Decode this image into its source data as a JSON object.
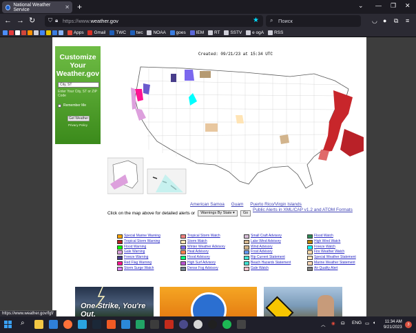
{
  "browser": {
    "tab_title": "National Weather Service",
    "url_prefix": "https://www.",
    "url_host": "weather.gov",
    "search_placeholder": "Поиск",
    "new_tab": "+",
    "bookmarks": [
      {
        "label": "Apps",
        "color": "#e5483a"
      },
      {
        "label": "Gmail",
        "color": "#d93025"
      },
      {
        "label": "TWC",
        "color": "#1f5fb8"
      },
      {
        "label": "twc",
        "color": "#1f5fb8"
      },
      {
        "label": "NOAA",
        "color": "#cfcfd8"
      },
      {
        "label": "goes",
        "color": "#3b7de0"
      },
      {
        "label": "IEM",
        "color": "#5a67d8"
      },
      {
        "label": "RT",
        "color": "#cfcfd8"
      },
      {
        "label": "SSTV",
        "color": "#cfcfd8"
      },
      {
        "label": "e ogA",
        "color": "#cfcfd8"
      },
      {
        "label": "RSS",
        "color": "#cfcfd8"
      }
    ]
  },
  "customize": {
    "title": "Customize Your Weather.gov",
    "input_value": "City, ST",
    "help": "Enter Your City, ST or ZIP Code",
    "remember": "Remember Me",
    "button": "Get Weather",
    "privacy": "Privacy Policy"
  },
  "map": {
    "created": "Created: 09/21/23 at 15:34 UTC",
    "links": [
      "American Samoa",
      "Guam",
      "Puerto Rico/Virgin Islands"
    ],
    "xml_link": "Public Alerts in XML/CAP v1.2 and ATOM Formats",
    "instruction": "Click on the map above for detailed alerts or",
    "select_value": "Warnings By State",
    "go": "Go"
  },
  "legend": {
    "col1": [
      {
        "label": "Special Marine Warning",
        "color": "#ffa500"
      },
      {
        "label": "Tropical Storm Warning",
        "color": "#b22222"
      },
      {
        "label": "Flood Warning",
        "color": "#00ff00"
      },
      {
        "label": "Gale Warning",
        "color": "#dda0dd"
      },
      {
        "label": "Freeze Warning",
        "color": "#483d8b"
      },
      {
        "label": "Red Flag Warning",
        "color": "#ff1493"
      },
      {
        "label": "Storm Surge Watch",
        "color": "#db7ff7"
      }
    ],
    "col2": [
      {
        "label": "Tropical Storm Watch",
        "color": "#f08080"
      },
      {
        "label": "Storm Watch",
        "color": "#ffe4b5"
      },
      {
        "label": "Winter Weather Advisory",
        "color": "#7b68ee"
      },
      {
        "label": "Heat Advisory",
        "color": "#ff7f50"
      },
      {
        "label": "Flood Advisory",
        "color": "#00ff7f"
      },
      {
        "label": "High Surf Advisory",
        "color": "#ba55d3"
      },
      {
        "label": "Dense Fog Advisory",
        "color": "#708090"
      }
    ],
    "col3": [
      {
        "label": "Small Craft Advisory",
        "color": "#d8bfd8"
      },
      {
        "label": "Lake Wind Advisory",
        "color": "#d2b48c"
      },
      {
        "label": "Wind Advisory",
        "color": "#d2b48c"
      },
      {
        "label": "Frost Advisory",
        "color": "#6495ed"
      },
      {
        "label": "Rip Current Statement",
        "color": "#40e0d0"
      },
      {
        "label": "Beach Hazards Statement",
        "color": "#40e0d0"
      },
      {
        "label": "Gale Watch",
        "color": "#ffc0cb"
      }
    ],
    "col4": [
      {
        "label": "Flood Watch",
        "color": "#2e8b57"
      },
      {
        "label": "High Wind Watch",
        "color": "#b8860b"
      },
      {
        "label": "Freeze Watch",
        "color": "#00ffff"
      },
      {
        "label": "Fire Weather Watch",
        "color": "#ffdead"
      },
      {
        "label": "Special Weather Statement",
        "color": "#ffe4b5"
      },
      {
        "label": "Marine Weather Statement",
        "color": "#ffdab9"
      },
      {
        "label": "Air Quality Alert",
        "color": "#808080"
      }
    ]
  },
  "banners": {
    "lightning": "One Strike, You're Out."
  },
  "status_url": "https://www.weather.gov/fgf/",
  "taskbar": {
    "lang": "ENG",
    "time": "11:34 AM",
    "date": "9/21/2023",
    "notifications": "3"
  }
}
